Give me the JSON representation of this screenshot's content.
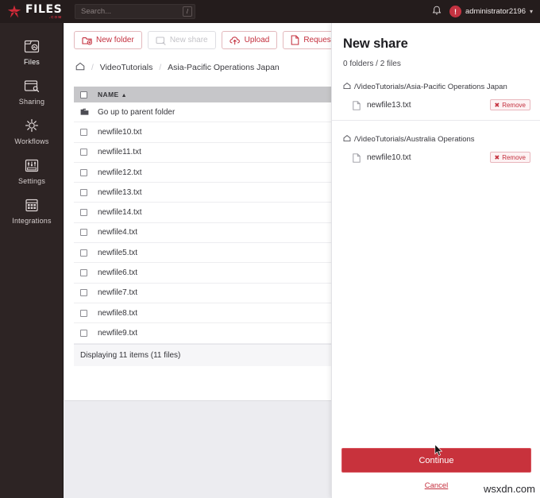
{
  "topbar": {
    "logo_text": "FILES",
    "logo_suffix": ".COM",
    "search_placeholder": "Search...",
    "search_value": "",
    "shortcut_key": "/",
    "notifications_icon": "bell-icon",
    "user_initial": "!",
    "user_name": "administrator2196",
    "caret": "⌄"
  },
  "sidebar": {
    "items": [
      {
        "label": "Files",
        "icon": "files-icon",
        "active": true
      },
      {
        "label": "Sharing",
        "icon": "sharing-icon",
        "active": false
      },
      {
        "label": "Workflows",
        "icon": "workflows-icon",
        "active": false
      },
      {
        "label": "Settings",
        "icon": "settings-icon",
        "active": false
      },
      {
        "label": "Integrations",
        "icon": "integrations-icon",
        "active": false
      }
    ]
  },
  "toolbar": {
    "new_folder": "New folder",
    "new_share": "New share",
    "upload": "Upload",
    "request": "Request",
    "link_icon": "link-icon",
    "more_icon": "chevron-right-icon"
  },
  "breadcrumb": {
    "home_icon": "home-icon",
    "separator": "/",
    "items": [
      "VideoTutorials",
      "Asia-Pacific Operations Japan"
    ]
  },
  "file_table": {
    "column_name": "NAME",
    "sort_direction": "▲",
    "parent_row": "Go up to parent folder",
    "rows": [
      "newfile10.txt",
      "newfile11.txt",
      "newfile12.txt",
      "newfile13.txt",
      "newfile14.txt",
      "newfile4.txt",
      "newfile5.txt",
      "newfile6.txt",
      "newfile7.txt",
      "newfile8.txt",
      "newfile9.txt"
    ],
    "footer": "Displaying 11 items (11 files)"
  },
  "drawer": {
    "title": "New share",
    "subtitle": "0 folders / 2 files",
    "groups": [
      {
        "path": "/VideoTutorials/Asia-Pacific Operations Japan",
        "files": [
          {
            "name": "newfile13.txt",
            "remove_label": "Remove"
          }
        ]
      },
      {
        "path": "/VideoTutorials/Australia Operations",
        "files": [
          {
            "name": "newfile10.txt",
            "remove_label": "Remove"
          }
        ]
      }
    ],
    "continue_label": "Continue",
    "cancel_label": "Cancel"
  },
  "watermark": "wsxdn.com",
  "colors": {
    "brand_red": "#c4303e",
    "button_red": "#c8323c",
    "topbar_dark": "#241c1c",
    "sidebar_dark": "#2d2424",
    "table_header_gray": "#c6c6c9"
  }
}
